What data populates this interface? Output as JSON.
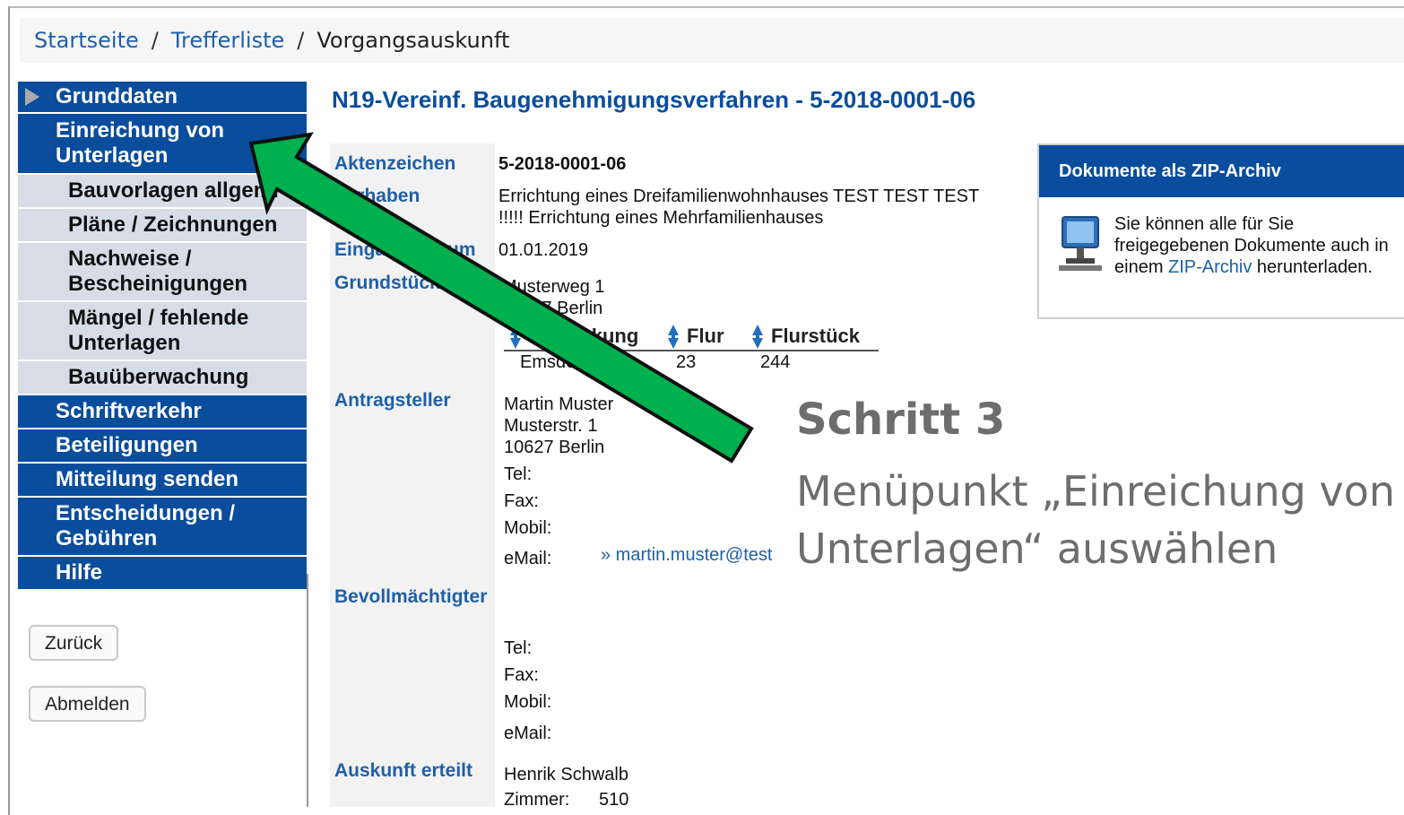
{
  "breadcrumb": {
    "items": [
      "Startseite",
      "Trefferliste"
    ],
    "current": "Vorgangsauskunft",
    "separator": "/"
  },
  "sidebar": {
    "items": [
      {
        "label": "Grunddaten"
      },
      {
        "label": "Einreichung von Unterlagen"
      },
      {
        "label": "Bauvorlagen allgem."
      },
      {
        "label": "Pläne / Zeichnungen"
      },
      {
        "label": "Nachweise / Bescheinigungen"
      },
      {
        "label": "Mängel / fehlende Unterlagen"
      },
      {
        "label": "Bauüberwachung"
      },
      {
        "label": "Schriftverkehr"
      },
      {
        "label": "Beteiligungen"
      },
      {
        "label": "Mitteilung senden"
      },
      {
        "label": "Entscheidungen / Gebühren"
      },
      {
        "label": "Hilfe"
      }
    ],
    "back_label": "Zurück",
    "logout_label": "Abmelden"
  },
  "main": {
    "title": "N19-Vereinf. Baugenehmigungsverfahren - 5-2018-0001-06",
    "labels": {
      "aktenzeichen": "Aktenzeichen",
      "vorhaben": "Vorhaben",
      "eingangsdatum": "Eingangsdatum",
      "grundstueck": "Grundstück",
      "antragsteller": "Antragsteller",
      "bevollmaechtigter": "Bevollmächtigter",
      "auskunft": "Auskunft erteilt"
    },
    "aktenzeichen": "5-2018-0001-06",
    "vorhaben_1": "Errichtung eines Dreifamilienwohnhauses TEST TEST TEST",
    "vorhaben_2": "!!!!! Errichtung eines Mehrfamilienhauses",
    "eingangsdatum": "01.01.2019",
    "grundstueck_street": "Musterweg 1",
    "grundstueck_city": "10627 Berlin",
    "parcel_headers": [
      "Gemarkung",
      "Flur",
      "Flurstück"
    ],
    "parcel_row": [
      "Emsdetten",
      "23",
      "244"
    ],
    "antragsteller": {
      "name": "Martin Muster",
      "street": "Musterstr. 1",
      "city": "10627 Berlin",
      "tel_label": "Tel:",
      "fax_label": "Fax:",
      "mobil_label": "Mobil:",
      "email_label": "eMail:",
      "email_value": "» martin.muster@test"
    },
    "bevollmaechtigter": {
      "tel_label": "Tel:",
      "fax_label": "Fax:",
      "mobil_label": "Mobil:",
      "email_label": "eMail:"
    },
    "auskunft": {
      "name": "Henrik Schwalb",
      "zimmer_label": "Zimmer:",
      "zimmer_value": "510"
    }
  },
  "zip": {
    "header": "Dokumente als ZIP-Archiv",
    "text_before": "Sie können alle für Sie freigegebenen Dokumente auch in einem ",
    "link": "ZIP-Archiv",
    "text_after": " herunterladen.",
    "icon": "computer-icon"
  },
  "annotation": {
    "step": "Schritt 3",
    "line1": "Menüpunkt „Einreichung von",
    "line2": "Unterlagen“ auswählen",
    "arrow_color": "#00b04f"
  }
}
